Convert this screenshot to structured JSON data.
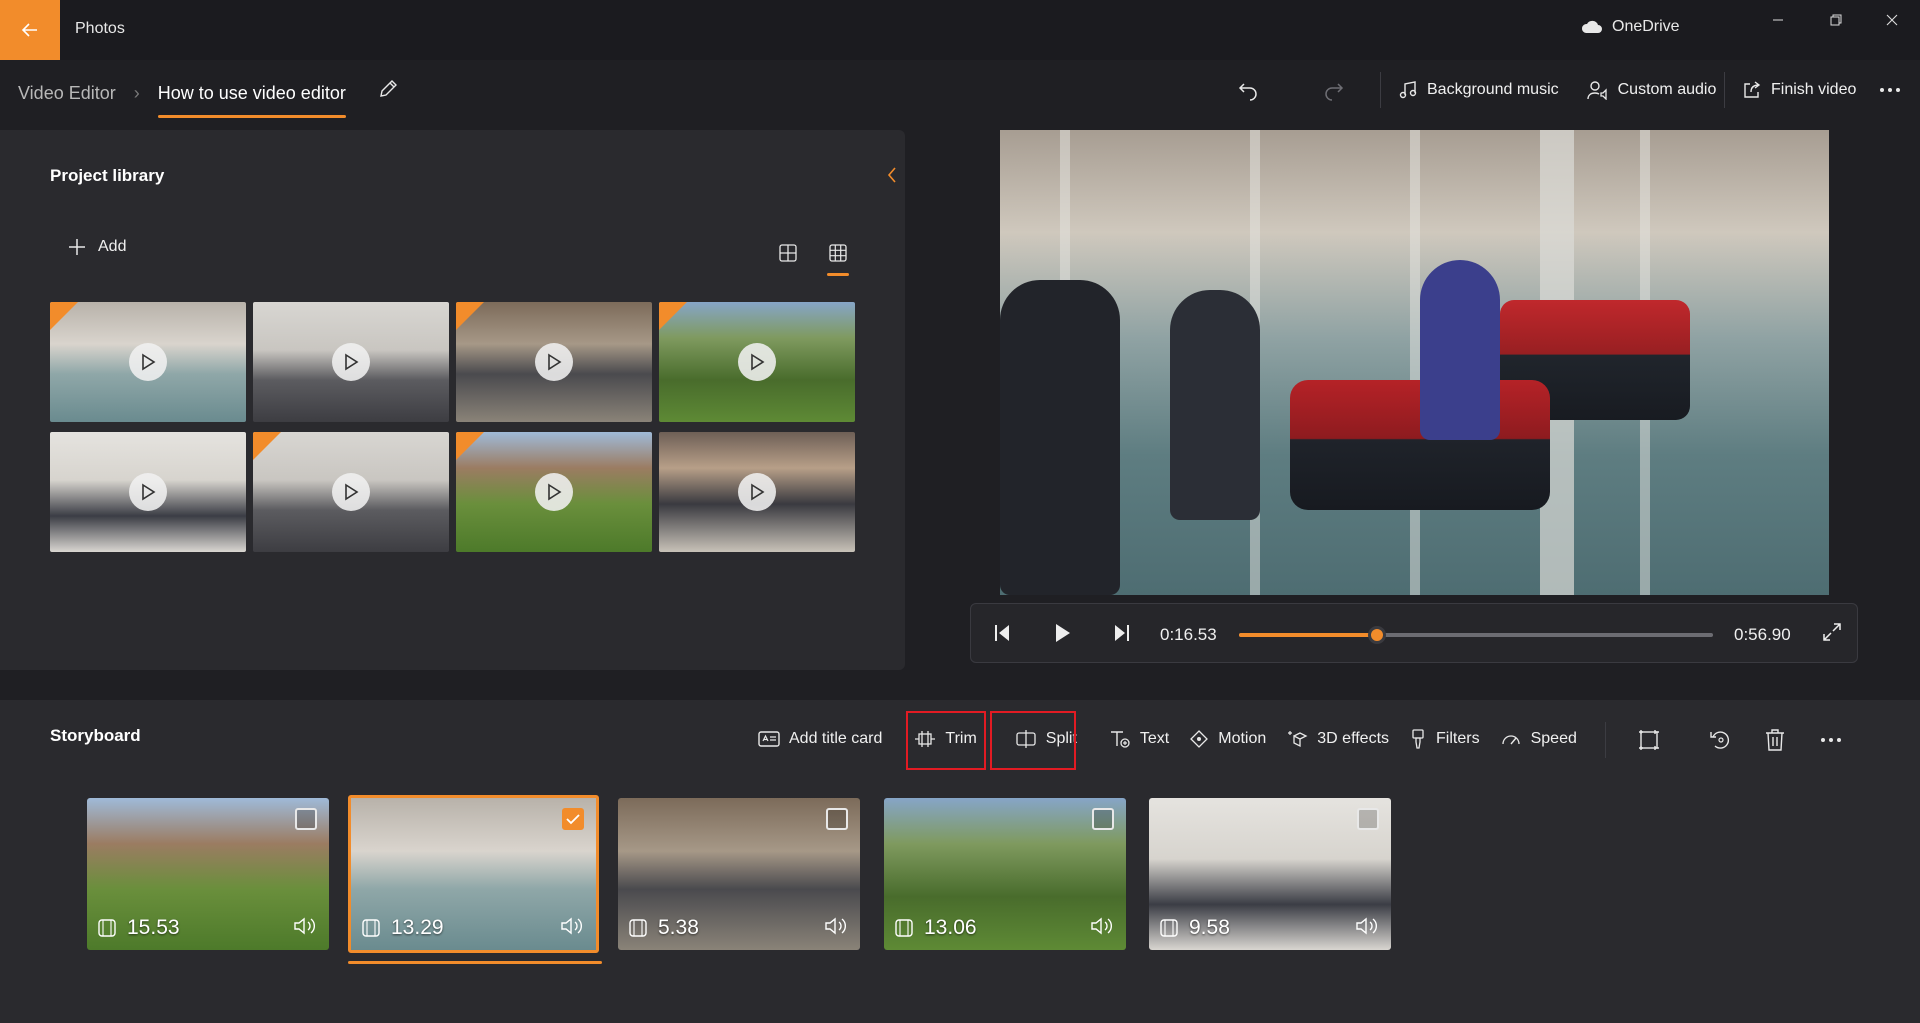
{
  "app": {
    "title": "Photos",
    "cloud_label": "OneDrive"
  },
  "breadcrumb": {
    "root": "Video Editor",
    "current": "How to use video editor"
  },
  "toolbar": {
    "background_music": "Background music",
    "custom_audio": "Custom audio",
    "finish_video": "Finish video"
  },
  "library": {
    "title": "Project library",
    "add_label": "Add",
    "items": [
      {
        "scene": "hall",
        "flag": true
      },
      {
        "scene": "class",
        "flag": false
      },
      {
        "scene": "picnic",
        "flag": true
      },
      {
        "scene": "lawn",
        "flag": true
      },
      {
        "scene": "lab",
        "flag": false
      },
      {
        "scene": "class",
        "flag": true
      },
      {
        "scene": "campus",
        "flag": true
      },
      {
        "scene": "atrium",
        "flag": false
      }
    ]
  },
  "player": {
    "current_time": "0:16.53",
    "total_time": "0:56.90",
    "progress": 0.2905
  },
  "storyboard": {
    "title": "Storyboard",
    "actions": {
      "add_title_card": "Add title card",
      "trim": "Trim",
      "split": "Split",
      "text": "Text",
      "motion": "Motion",
      "effects_3d": "3D effects",
      "filters": "Filters",
      "speed": "Speed"
    },
    "clips": [
      {
        "duration": "15.53",
        "scene": "campus",
        "selected": false
      },
      {
        "duration": "13.29",
        "scene": "hall",
        "selected": true
      },
      {
        "duration": "5.38",
        "scene": "picnic",
        "selected": false
      },
      {
        "duration": "13.06",
        "scene": "lawn",
        "selected": false
      },
      {
        "duration": "9.58",
        "scene": "lab",
        "selected": false
      }
    ]
  },
  "colors": {
    "accent": "#f28c2b",
    "highlight": "#e21b23",
    "panel": "#2a2a2e",
    "background": "#1f1f23"
  }
}
